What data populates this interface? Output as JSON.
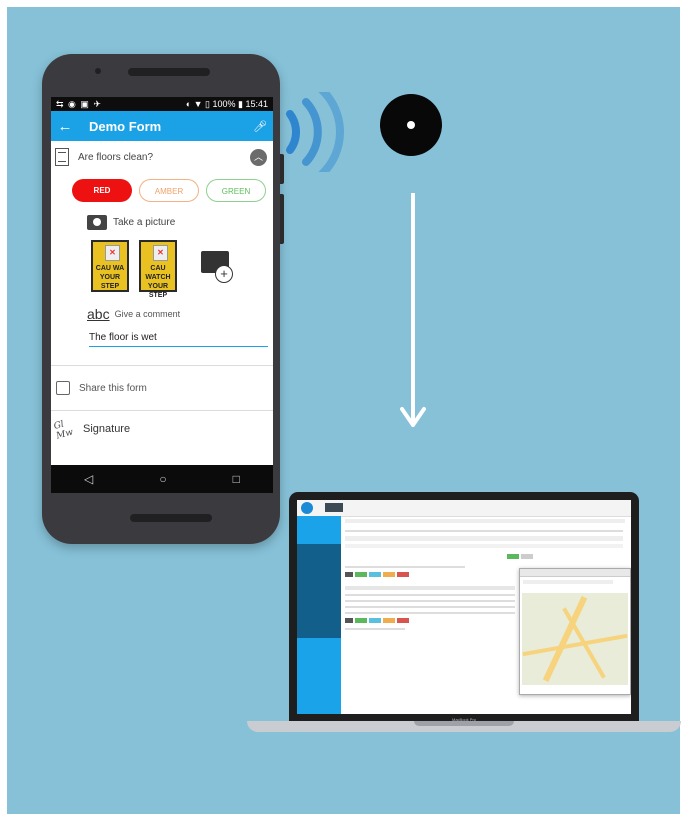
{
  "phone": {
    "status": {
      "left_icons": "⇆ ◉ ▣ ✈",
      "right": "◐ ▼ ▯ 100% ▮ 15:41"
    },
    "appbar": {
      "back_icon": "arrow-left-icon",
      "title": "Demo Form",
      "mic_icon": "mic-icon"
    },
    "question": {
      "text": "Are floors clean?",
      "icon": "document-icon",
      "collapse_icon": "chevron-up-icon"
    },
    "choices": [
      {
        "label": "RED",
        "color": "#ee1111",
        "selected": true
      },
      {
        "label": "AMBER",
        "color": "#f0a268",
        "selected": false
      },
      {
        "label": "GREEN",
        "color": "#5cbf5c",
        "selected": false
      }
    ],
    "picture": {
      "label": "Take a picture",
      "icon": "camera-icon",
      "thumb_caption_1": "CAU WA YOUR STEP",
      "thumb_caption_2": "CAU WATCH YOUR STEP"
    },
    "comment": {
      "icon_text": "abc",
      "label": "Give a comment",
      "value": "The floor is wet"
    },
    "share": {
      "label": "Share this form",
      "checked": false
    },
    "signature": {
      "label": "Signature",
      "icon_text": "Gl Mw"
    },
    "nav": {
      "back": "◁",
      "home": "○",
      "recents": "□"
    }
  },
  "tag": {
    "icon": "nfc-tag-icon"
  },
  "laptop": {
    "model_label": "MacBook Pro"
  },
  "colors": {
    "background": "#86c1d8",
    "accent": "#1aa1e6",
    "phone_body": "#3b3b3f"
  }
}
